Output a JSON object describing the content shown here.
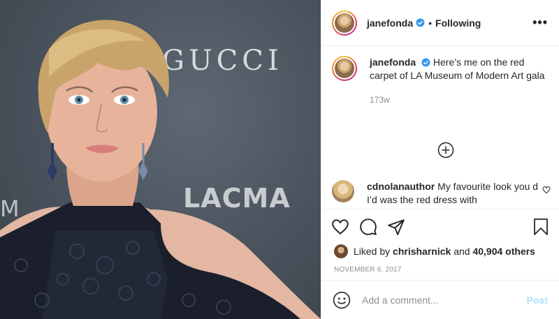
{
  "photo": {
    "watermarks": {
      "gucci": "GUCCI",
      "lacma": "LACMA",
      "edge": "M"
    }
  },
  "header": {
    "username": "janefonda",
    "separator": "•",
    "follow_status": "Following",
    "more_label": "•••"
  },
  "caption": {
    "username": "janefonda",
    "text": "Here’s me on the red carpet of LA Museum of Modern Art gala",
    "timestamp": "173w"
  },
  "comment": {
    "username": "cdnolanauthor",
    "text": "My favourite look you d I’d was the red dress with"
  },
  "likes": {
    "prefix": "Liked by",
    "user": "chrisharnick",
    "conjunction": "and",
    "count": "40,904 others"
  },
  "post_date": "NOVEMBER 6, 2017",
  "add_comment": {
    "placeholder": "Add a comment...",
    "post_label": "Post"
  },
  "colors": {
    "verified_blue": "#3897f0",
    "post_disabled": "#b2dffc",
    "secondary_text": "#8e8e8e"
  }
}
